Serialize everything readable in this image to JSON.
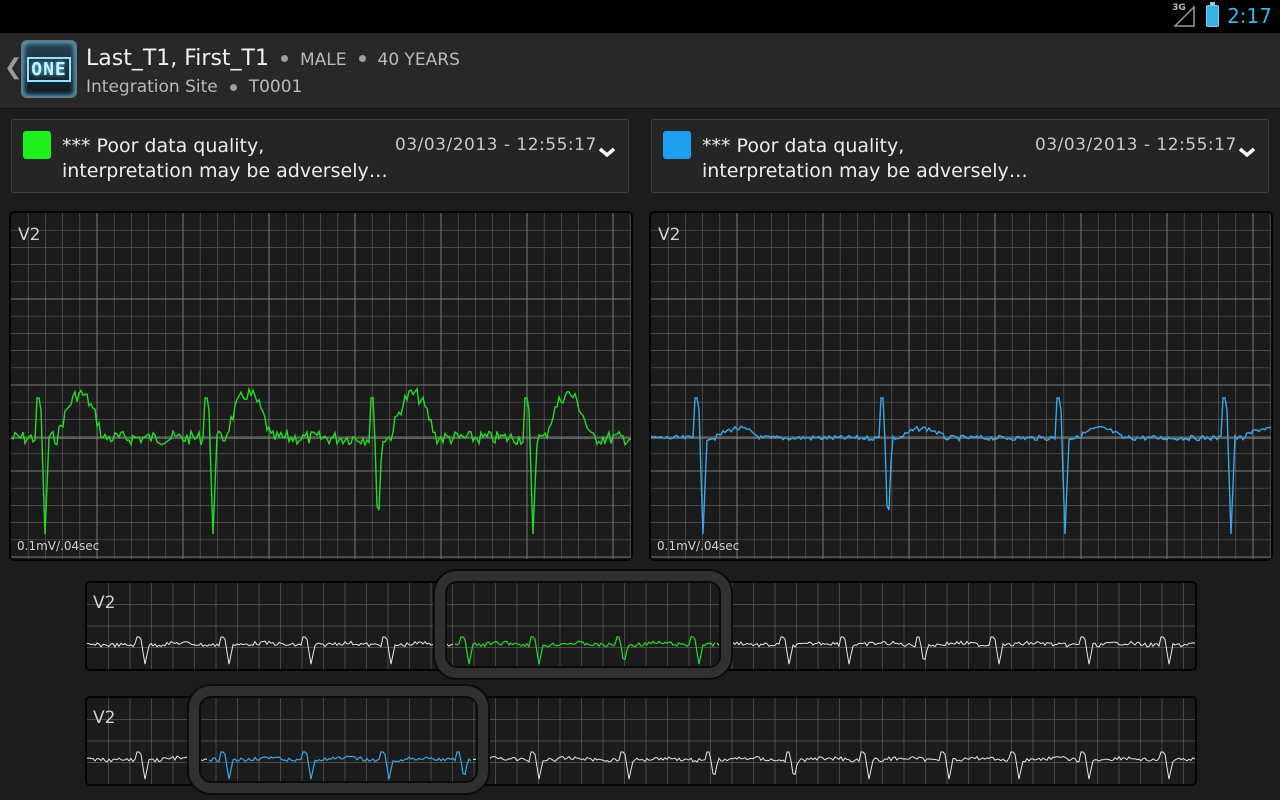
{
  "status_bar": {
    "network": "3G",
    "time": "2:17"
  },
  "header": {
    "patient_name": "Last_T1, First_T1",
    "sex": "MALE",
    "age": "40 YEARS",
    "site": "Integration Site",
    "patient_id": "T0001",
    "logo_text": "ONE"
  },
  "notes": [
    {
      "color": "#1ef01e",
      "line1": "*** Poor data quality,",
      "line2": "interpretation may be adversely…",
      "date": "03/03/2013 - 12:55:17"
    },
    {
      "color": "#1fa0ef",
      "line1": "*** Poor data quality,",
      "line2": "interpretation may be adversely…",
      "date": "03/03/2013 - 12:55:17"
    }
  ],
  "panels": [
    {
      "lead": "V2",
      "scale": "0.1mV/.04sec",
      "trace_color": "#22dd22"
    },
    {
      "lead": "V2",
      "scale": "0.1mV/.04sec",
      "trace_color": "#3aa6e6"
    }
  ],
  "strips": [
    {
      "lead": "V2",
      "highlight_color": "#22dd22"
    },
    {
      "lead": "V2",
      "highlight_color": "#3aa6e6"
    }
  ]
}
